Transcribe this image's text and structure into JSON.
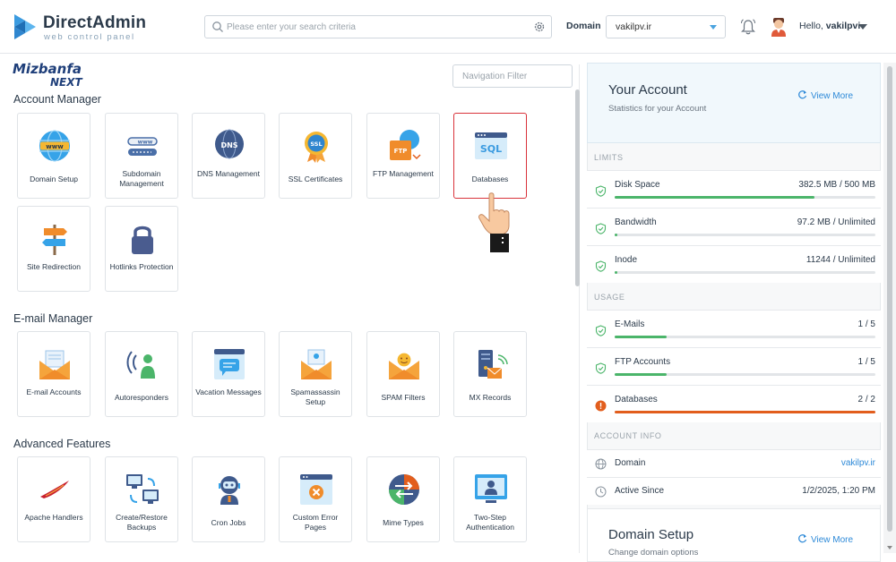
{
  "header": {
    "logo_title": "DirectAdmin",
    "logo_subtitle": "web control panel",
    "search_placeholder": "Please enter your search criteria",
    "domain_label": "Domain",
    "domain_value": "vakilpv.ir",
    "hello_prefix": "Hello,",
    "username": "vakilpvi"
  },
  "brand": {
    "line1": "Mizbanfa",
    "line2": "NEXT"
  },
  "nav_filter_placeholder": "Navigation Filter",
  "sections": {
    "account_manager": "Account Manager",
    "email_manager": "E-mail Manager",
    "advanced_features": "Advanced Features"
  },
  "tiles": {
    "domain_setup": "Domain Setup",
    "subdomain_management": "Subdomain Management",
    "dns_management": "DNS Management",
    "ssl_certificates": "SSL Certificates",
    "ftp_management": "FTP Management",
    "databases": "Databases",
    "site_redirection": "Site Redirection",
    "hotlinks_protection": "Hotlinks Protection",
    "email_accounts": "E-mail Accounts",
    "autoresponders": "Autoresponders",
    "vacation_messages": "Vacation Messages",
    "spamassassin_setup": "Spamassassin Setup",
    "spam_filters": "SPAM Filters",
    "mx_records": "MX Records",
    "apache_handlers": "Apache Handlers",
    "create_restore_backups": "Create/Restore Backups",
    "cron_jobs": "Cron Jobs",
    "custom_error_pages": "Custom Error Pages",
    "mime_types": "Mime Types",
    "two_step_authentication": "Two-Step Authentication"
  },
  "icon_text": {
    "www": "www",
    "dns": "DNS",
    "ssl": "SSL",
    "ftp": "FTP",
    "sql": "SQL"
  },
  "account": {
    "title": "Your Account",
    "subtitle": "Statistics for your Account",
    "view_more": "View More",
    "limits_label": "LIMITS",
    "usage_label": "USAGE",
    "info_label": "ACCOUNT INFO",
    "limits": [
      {
        "name": "Disk Space",
        "value": "382.5 MB / 500 MB",
        "fill": 0.765
      },
      {
        "name": "Bandwidth",
        "value": "97.2 MB / Unlimited",
        "fill": 0.01
      },
      {
        "name": "Inode",
        "value": "11244 / Unlimited",
        "fill": 0.01
      }
    ],
    "usage": [
      {
        "name": "E-Mails",
        "value": "1 / 5",
        "fill": 0.2
      },
      {
        "name": "FTP Accounts",
        "value": "1 / 5",
        "fill": 0.2
      },
      {
        "name": "Databases",
        "value": "2 / 2",
        "fill": 1.0
      }
    ],
    "info": [
      {
        "name": "Domain",
        "value": "vakilpv.ir"
      },
      {
        "name": "Active Since",
        "value": "1/2/2025, 1:20 PM"
      }
    ]
  },
  "domain_setup_card": {
    "title": "Domain Setup",
    "subtitle": "Change domain options",
    "view_more": "View More"
  },
  "colors": {
    "accent": "#2e8ad8",
    "success": "#4bb56a",
    "danger": "#e25e1d",
    "selected_border": "#d9333b"
  }
}
